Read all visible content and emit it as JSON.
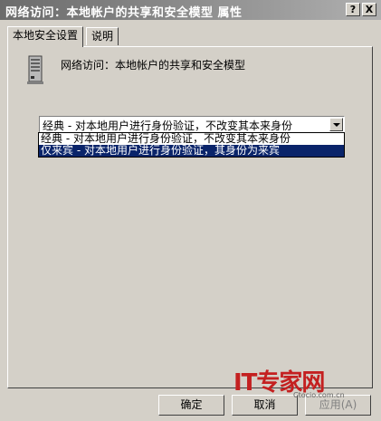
{
  "window": {
    "title": "网络访问：本地帐户的共享和安全模型 属性",
    "help_glyph": "?",
    "close_glyph": "X"
  },
  "tabs": [
    {
      "label": "本地安全设置",
      "active": true
    },
    {
      "label": "说明",
      "active": false
    }
  ],
  "policy": {
    "icon": "server-policy-icon",
    "name": "网络访问：本地帐户的共享和安全模型"
  },
  "combo": {
    "selected": "经典 - 对本地用户进行身份验证，不改变其本来身份"
  },
  "dropdown": {
    "options": [
      {
        "label": "经典 - 对本地用户进行身份验证，不改变其本来身份",
        "selected": false
      },
      {
        "label": "仅来宾 - 对本地用户进行身份验证，其身份为来宾",
        "selected": true
      }
    ]
  },
  "buttons": {
    "ok": "确定",
    "cancel": "取消",
    "apply": "应用(A)"
  },
  "watermark": {
    "brand": "IT专家网",
    "url": "Ctocio.com.cn"
  },
  "colors": {
    "highlight": "#0a246a",
    "face": "#d4d0c8",
    "watermark": "#c42020"
  }
}
